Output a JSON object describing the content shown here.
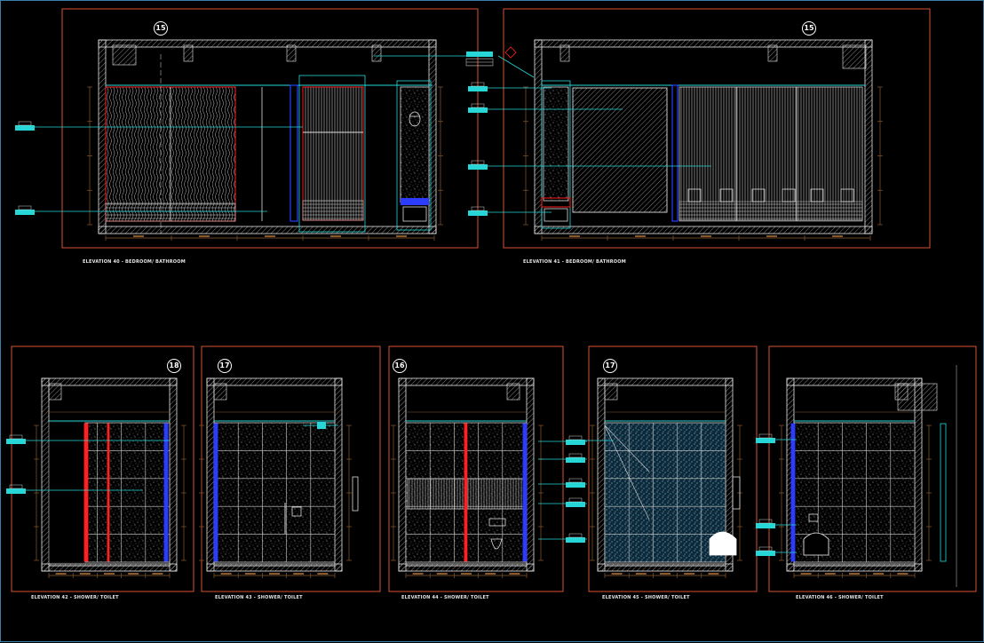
{
  "drawing": {
    "background": "#000000",
    "colors": {
      "frame": "#d9502f",
      "wall": "#e8e8e8",
      "tile": "#cfcfcf",
      "accent_red": "#ff2020",
      "accent_blue": "#2c3cff",
      "cyan": "#27d7d7",
      "dim": "#8a5a2f",
      "label": "#35c4c4"
    },
    "elevations": [
      {
        "tag": "15",
        "caption": "ELEVATION 40 - BEDROOM/ BATHROOM"
      },
      {
        "tag": "15",
        "caption": "ELEVATION 41 - BEDROOM/ BATHROOM"
      },
      {
        "tag": "18",
        "caption": "ELEVATION 42 - SHOWER/ TOILET"
      },
      {
        "tag": "17",
        "caption": "ELEVATION 43 - SHOWER/ TOILET"
      },
      {
        "tag": "16",
        "caption": "ELEVATION 44 - SHOWER/ TOILET"
      },
      {
        "tag": "17",
        "caption": "ELEVATION 45 - SHOWER/ TOILET"
      },
      {
        "tag": "",
        "caption": "ELEVATION 46 - SHOWER/ TOILET"
      }
    ]
  }
}
